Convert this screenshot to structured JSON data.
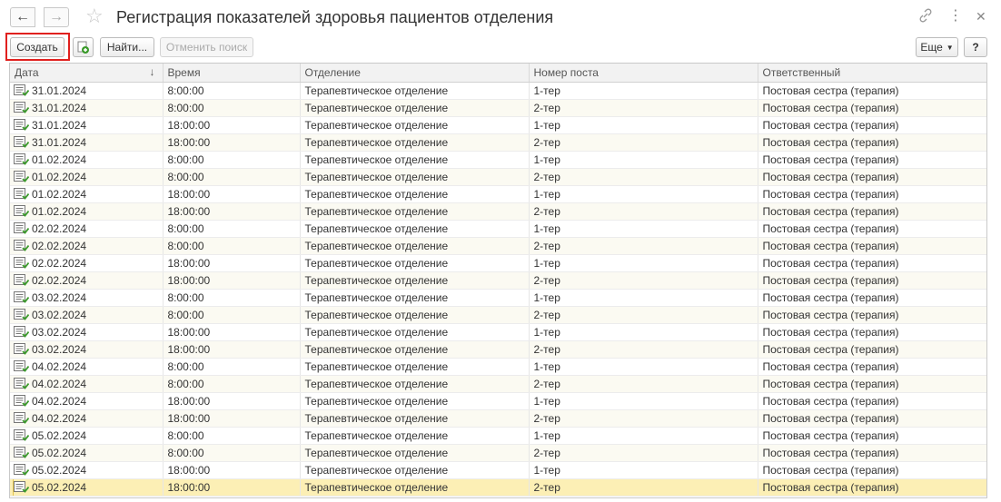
{
  "window": {
    "title": "Регистрация показателей здоровья пациентов отделения",
    "icons": {
      "back": "arrow-left-icon",
      "forward": "arrow-right-icon",
      "favorite": "star-icon",
      "link": "link-icon",
      "more": "vertical-dots-icon",
      "close": "close-icon"
    }
  },
  "toolbar": {
    "create_label": "Создать",
    "copy_icon": "copy-document-icon",
    "find_label": "Найти...",
    "cancel_search_label": "Отменить поиск",
    "more_label": "Еще",
    "help_label": "?"
  },
  "table": {
    "columns": [
      "Дата",
      "Время",
      "Отделение",
      "Номер поста",
      "Ответственный"
    ],
    "sort_indicator": "↓",
    "row_icon": "document-posted-icon",
    "selected_row": 23,
    "rows": [
      {
        "date": "31.01.2024",
        "time": "8:00:00",
        "dept": "Терапевтическое отделение",
        "post": "1-тер",
        "resp": "Постовая сестра (терапия)"
      },
      {
        "date": "31.01.2024",
        "time": "8:00:00",
        "dept": "Терапевтическое отделение",
        "post": "2-тер",
        "resp": "Постовая сестра (терапия)"
      },
      {
        "date": "31.01.2024",
        "time": "18:00:00",
        "dept": "Терапевтическое отделение",
        "post": "1-тер",
        "resp": "Постовая сестра (терапия)"
      },
      {
        "date": "31.01.2024",
        "time": "18:00:00",
        "dept": "Терапевтическое отделение",
        "post": "2-тер",
        "resp": "Постовая сестра (терапия)"
      },
      {
        "date": "01.02.2024",
        "time": "8:00:00",
        "dept": "Терапевтическое отделение",
        "post": "1-тер",
        "resp": "Постовая сестра (терапия)"
      },
      {
        "date": "01.02.2024",
        "time": "8:00:00",
        "dept": "Терапевтическое отделение",
        "post": "2-тер",
        "resp": "Постовая сестра (терапия)"
      },
      {
        "date": "01.02.2024",
        "time": "18:00:00",
        "dept": "Терапевтическое отделение",
        "post": "1-тер",
        "resp": "Постовая сестра (терапия)"
      },
      {
        "date": "01.02.2024",
        "time": "18:00:00",
        "dept": "Терапевтическое отделение",
        "post": "2-тер",
        "resp": "Постовая сестра (терапия)"
      },
      {
        "date": "02.02.2024",
        "time": "8:00:00",
        "dept": "Терапевтическое отделение",
        "post": "1-тер",
        "resp": "Постовая сестра (терапия)"
      },
      {
        "date": "02.02.2024",
        "time": "8:00:00",
        "dept": "Терапевтическое отделение",
        "post": "2-тер",
        "resp": "Постовая сестра (терапия)"
      },
      {
        "date": "02.02.2024",
        "time": "18:00:00",
        "dept": "Терапевтическое отделение",
        "post": "1-тер",
        "resp": "Постовая сестра (терапия)"
      },
      {
        "date": "02.02.2024",
        "time": "18:00:00",
        "dept": "Терапевтическое отделение",
        "post": "2-тер",
        "resp": "Постовая сестра (терапия)"
      },
      {
        "date": "03.02.2024",
        "time": "8:00:00",
        "dept": "Терапевтическое отделение",
        "post": "1-тер",
        "resp": "Постовая сестра (терапия)"
      },
      {
        "date": "03.02.2024",
        "time": "8:00:00",
        "dept": "Терапевтическое отделение",
        "post": "2-тер",
        "resp": "Постовая сестра (терапия)"
      },
      {
        "date": "03.02.2024",
        "time": "18:00:00",
        "dept": "Терапевтическое отделение",
        "post": "1-тер",
        "resp": "Постовая сестра (терапия)"
      },
      {
        "date": "03.02.2024",
        "time": "18:00:00",
        "dept": "Терапевтическое отделение",
        "post": "2-тер",
        "resp": "Постовая сестра (терапия)"
      },
      {
        "date": "04.02.2024",
        "time": "8:00:00",
        "dept": "Терапевтическое отделение",
        "post": "1-тер",
        "resp": "Постовая сестра (терапия)"
      },
      {
        "date": "04.02.2024",
        "time": "8:00:00",
        "dept": "Терапевтическое отделение",
        "post": "2-тер",
        "resp": "Постовая сестра (терапия)"
      },
      {
        "date": "04.02.2024",
        "time": "18:00:00",
        "dept": "Терапевтическое отделение",
        "post": "1-тер",
        "resp": "Постовая сестра (терапия)"
      },
      {
        "date": "04.02.2024",
        "time": "18:00:00",
        "dept": "Терапевтическое отделение",
        "post": "2-тер",
        "resp": "Постовая сестра (терапия)"
      },
      {
        "date": "05.02.2024",
        "time": "8:00:00",
        "dept": "Терапевтическое отделение",
        "post": "1-тер",
        "resp": "Постовая сестра (терапия)"
      },
      {
        "date": "05.02.2024",
        "time": "8:00:00",
        "dept": "Терапевтическое отделение",
        "post": "2-тер",
        "resp": "Постовая сестра (терапия)"
      },
      {
        "date": "05.02.2024",
        "time": "18:00:00",
        "dept": "Терапевтическое отделение",
        "post": "1-тер",
        "resp": "Постовая сестра (терапия)"
      },
      {
        "date": "05.02.2024",
        "time": "18:00:00",
        "dept": "Терапевтическое отделение",
        "post": "2-тер",
        "resp": "Постовая сестра (терапия)"
      }
    ]
  },
  "colors": {
    "highlight_border": "#e0201e",
    "selected_row": "#fcefb5",
    "icon_green": "#3a9a2a"
  }
}
